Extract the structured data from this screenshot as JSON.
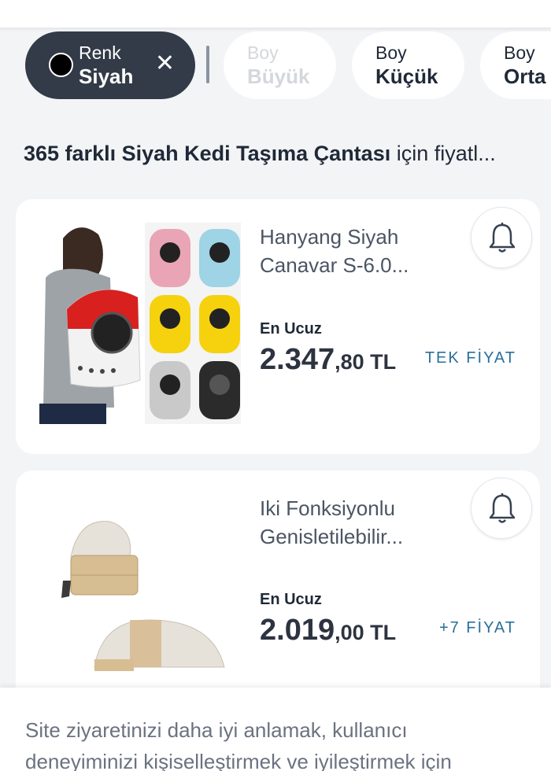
{
  "filters": {
    "active": {
      "key": "Renk",
      "value": "Siyah",
      "swatch_color": "#000000"
    },
    "chips": [
      {
        "key": "Boy",
        "value": "Büyük",
        "disabled": true
      },
      {
        "key": "Boy",
        "value": "Küçük",
        "disabled": false
      },
      {
        "key": "Boy",
        "value": "Orta",
        "disabled": false
      }
    ]
  },
  "heading": {
    "bold": "365 farklı Siyah Kedi Taşıma Çantası",
    "rest": " için fiyatl..."
  },
  "products": [
    {
      "title_line1": "Hanyang Siyah",
      "title_line2": "Canavar S-6.0...",
      "price_label": "En Ucuz",
      "price_main": "2.347",
      "price_decimal": ",80 TL",
      "offers": "TEK FİYAT",
      "bell_icon": "bell-icon"
    },
    {
      "title_line1": "Iki Fonksiyonlu",
      "title_line2": "Genisletilebilir...",
      "price_label": "En Ucuz",
      "price_main": "2.019",
      "price_decimal": ",00 TL",
      "offers": "+7 FİYAT",
      "bell_icon": "bell-icon"
    }
  ],
  "cookie_notice": {
    "line1": "Site ziyaretinizi daha iyi anlamak, kullanıcı",
    "line2": "deneyiminizi kişiselleştirmek ve iyileştirmek için"
  },
  "colors": {
    "active_chip": "#333b48",
    "accent_link": "#2a6f9b",
    "background": "#f3f4f6"
  }
}
